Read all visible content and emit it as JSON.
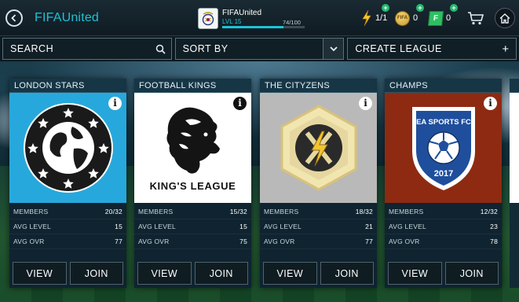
{
  "app": {
    "title": "FIFAUnited"
  },
  "profile": {
    "name": "FIFAUnited",
    "level": "LVL 15",
    "xp_text": "74/100",
    "xp_fraction": 0.74
  },
  "currencies": {
    "energy": "1/1",
    "coins_label": "FIFA",
    "coins": "0",
    "points_label": "F",
    "points": "0"
  },
  "controls": {
    "search_label": "SEARCH",
    "sort_label": "SORT BY",
    "create_label": "CREATE LEAGUE",
    "create_plus": "+"
  },
  "cards": [
    {
      "title": "LONDON STARS",
      "members_label": "MEMBERS",
      "members": "20/32",
      "level_label": "AVG LEVEL",
      "level": "15",
      "ovr_label": "AVG OVR",
      "ovr": "77",
      "view_label": "VIEW",
      "join_label": "JOIN",
      "bg": "#27a8dc"
    },
    {
      "title": "FOOTBALL KINGS",
      "members_label": "MEMBERS",
      "members": "15/32",
      "level_label": "AVG LEVEL",
      "level": "15",
      "ovr_label": "AVG OVR",
      "ovr": "75",
      "view_label": "VIEW",
      "join_label": "JOIN",
      "logo_text": "KING'S LEAGUE",
      "bg": "#ffffff"
    },
    {
      "title": "THE CITYZENS",
      "members_label": "MEMBERS",
      "members": "18/32",
      "level_label": "AVG LEVEL",
      "level": "21",
      "ovr_label": "AVG OVR",
      "ovr": "77",
      "view_label": "VIEW",
      "join_label": "JOIN",
      "bg": "#b9b9b9"
    },
    {
      "title": "CHAMPS",
      "members_label": "MEMBERS",
      "members": "12/32",
      "level_label": "AVG LEVEL",
      "level": "23",
      "ovr_label": "AVG OVR",
      "ovr": "78",
      "view_label": "VIEW",
      "join_label": "JOIN",
      "logo_top": "EA SPORTS FC",
      "logo_year": "2017",
      "bg": "#8f2a12"
    }
  ],
  "colors": {
    "accent": "#1ec2d6",
    "positive": "#26b870"
  }
}
